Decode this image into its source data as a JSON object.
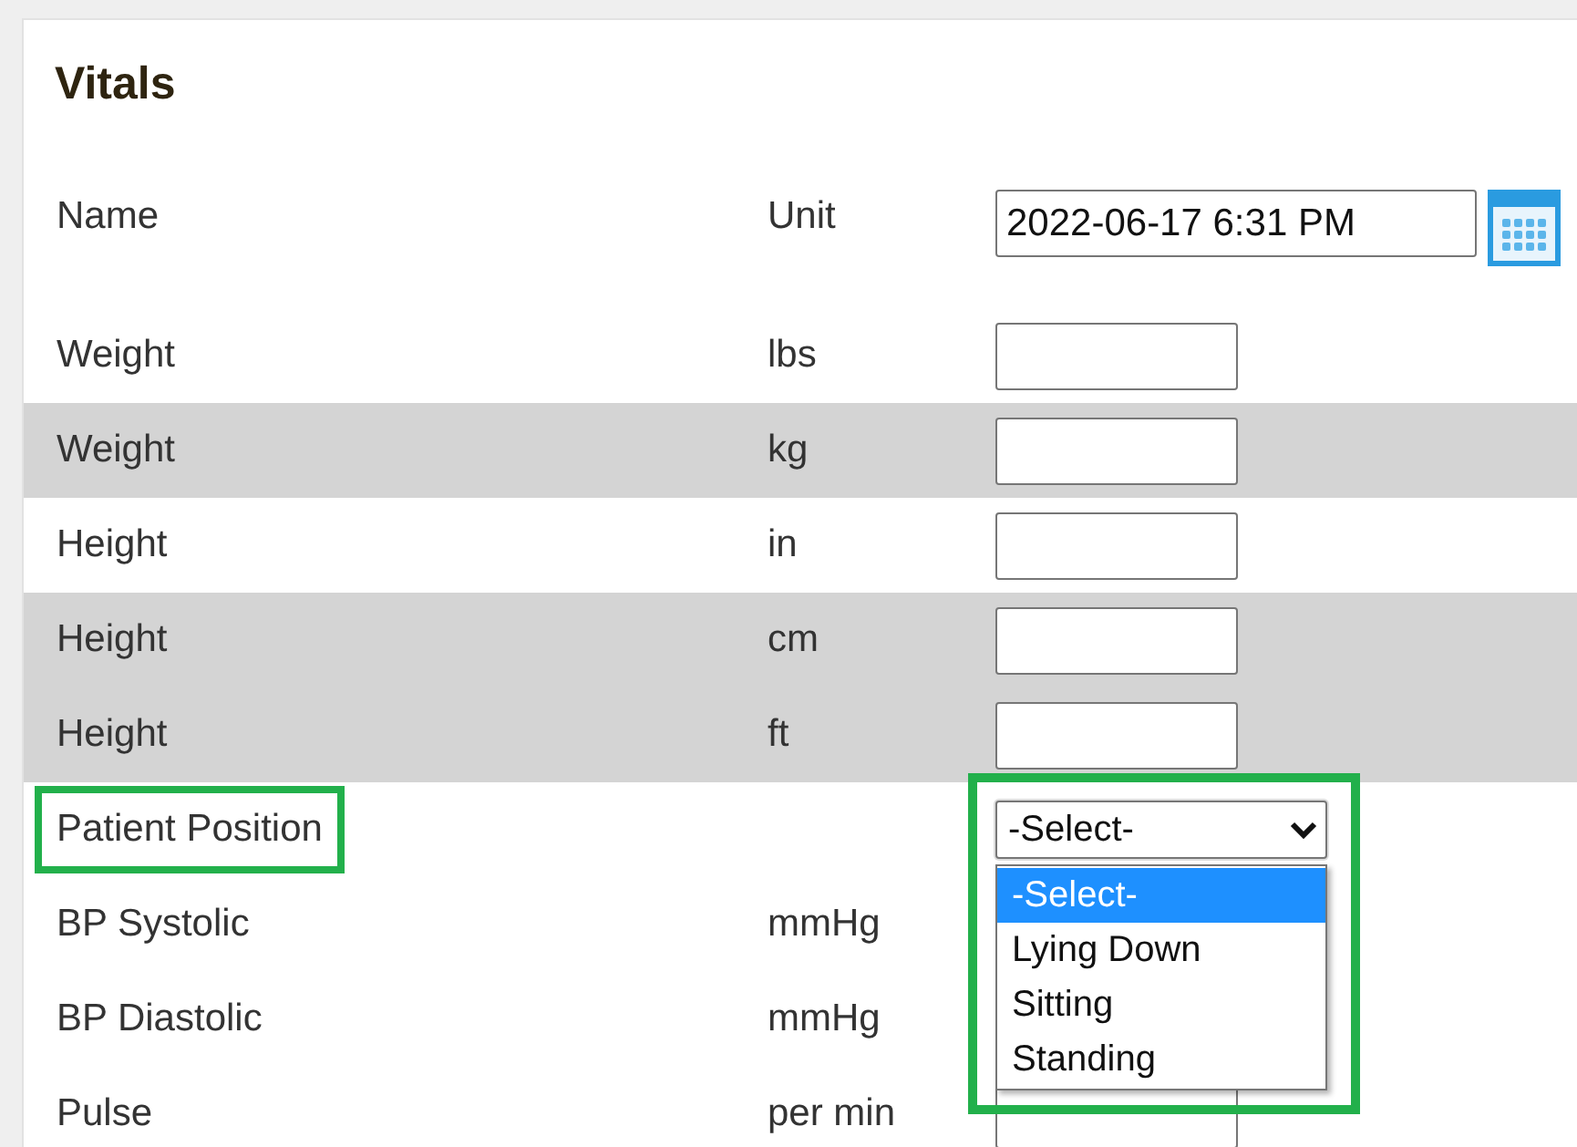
{
  "title": "Vitals",
  "header": {
    "label": "Name",
    "unit": "Unit",
    "value": "2022-06-17 6:31 PM"
  },
  "rows": [
    {
      "kind": "input",
      "label": "Weight",
      "unit": "lbs",
      "shaded": false
    },
    {
      "kind": "input",
      "label": "Weight",
      "unit": "kg",
      "shaded": true
    },
    {
      "kind": "input",
      "label": "Height",
      "unit": "in",
      "shaded": false
    },
    {
      "kind": "input",
      "label": "Height",
      "unit": "cm",
      "shaded": true
    },
    {
      "kind": "input",
      "label": "Height",
      "unit": "ft",
      "shaded": true
    },
    {
      "kind": "select",
      "label": "Patient Position",
      "shaded": false,
      "highlighted": true,
      "value": "-Select-",
      "expanded": true,
      "options": [
        {
          "label": "-Select-",
          "selected": true
        },
        {
          "label": "Lying Down",
          "selected": false
        },
        {
          "label": "Sitting",
          "selected": false
        },
        {
          "label": "Standing",
          "selected": false
        }
      ]
    },
    {
      "kind": "text",
      "label": "BP Systolic",
      "unit": "mmHg",
      "shaded": false
    },
    {
      "kind": "text",
      "label": "BP Diastolic",
      "unit": "mmHg",
      "shaded": false
    },
    {
      "kind": "input",
      "label": "Pulse",
      "unit": "per min",
      "shaded": false
    }
  ]
}
